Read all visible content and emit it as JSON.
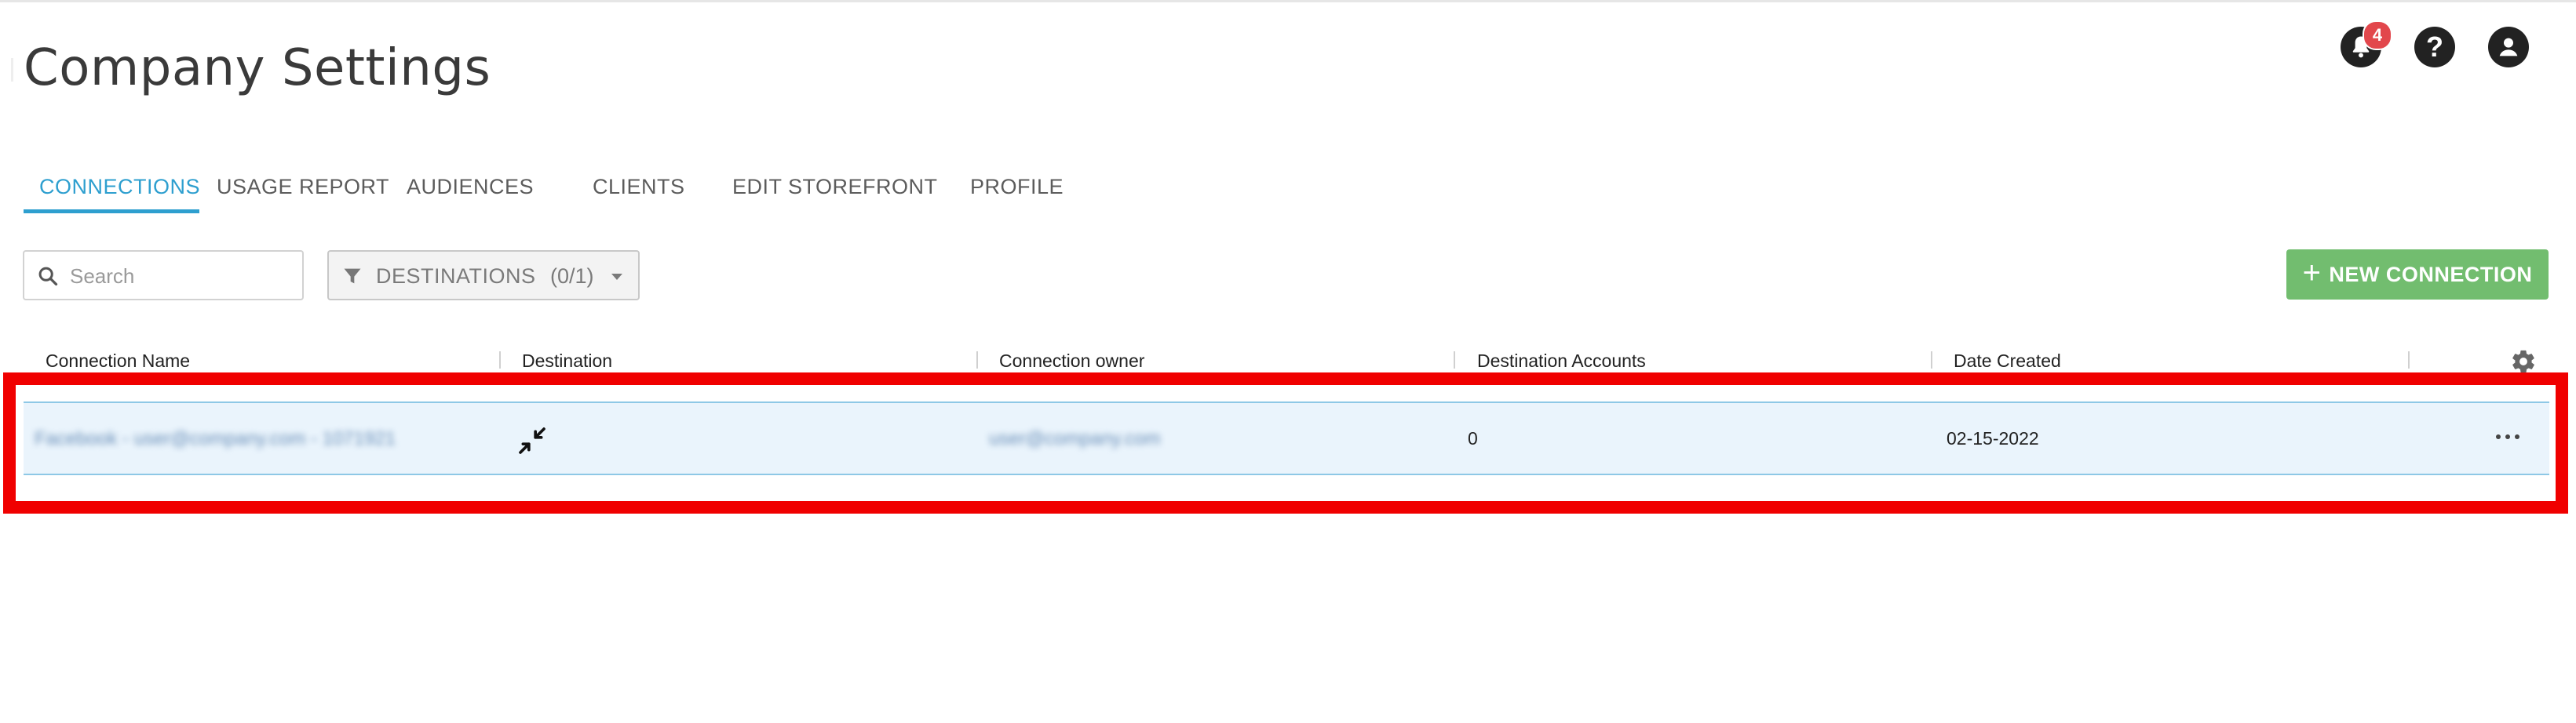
{
  "page": {
    "title": "Company Settings"
  },
  "header": {
    "notification_count": "4",
    "icons": [
      "bell-icon",
      "help-icon",
      "user-account-icon"
    ]
  },
  "tabs": [
    {
      "label": "CONNECTIONS",
      "active": true
    },
    {
      "label": "USAGE REPORT",
      "active": false
    },
    {
      "label": "AUDIENCES",
      "active": false
    },
    {
      "label": "CLIENTS",
      "active": false
    },
    {
      "label": "EDIT STOREFRONT",
      "active": false
    },
    {
      "label": "PROFILE",
      "active": false
    }
  ],
  "toolbar": {
    "search_placeholder": "Search",
    "filter_label": "DESTINATIONS",
    "filter_count": "(0/1)",
    "new_connection_label": "NEW CONNECTION"
  },
  "table": {
    "columns": [
      "Connection Name",
      "Destination",
      "Connection owner",
      "Destination Accounts",
      "Date Created"
    ],
    "rows": [
      {
        "connection_name": "Facebook - user@company.com - 1071921",
        "destination_icon": "compress-arrows-icon",
        "connection_owner": "user@company.com",
        "destination_accounts": "0",
        "date_created": "02-15-2022"
      }
    ]
  },
  "colors": {
    "accent": "#2e9fcf",
    "new_button": "#72bd6f",
    "badge": "#e2474c",
    "selected_row": "#eaf4fc",
    "highlight": "#f00000"
  }
}
